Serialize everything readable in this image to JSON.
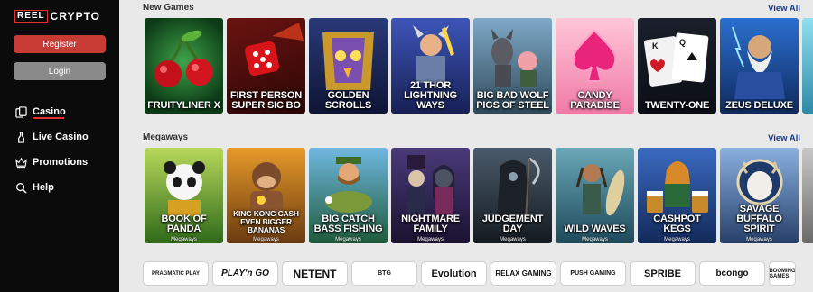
{
  "brand": {
    "reel": "REEL",
    "crypto": "CRYPTO"
  },
  "auth": {
    "register": "Register",
    "login": "Login"
  },
  "nav": [
    {
      "label": "Casino",
      "icon": "cards-icon"
    },
    {
      "label": "Live Casino",
      "icon": "bottle-icon"
    },
    {
      "label": "Promotions",
      "icon": "crown-icon"
    },
    {
      "label": "Help",
      "icon": "search-icon"
    }
  ],
  "sections": [
    {
      "title": "New Games",
      "view_all": "View All",
      "games": [
        {
          "title": "FRUITYLINER X",
          "sub": ""
        },
        {
          "title": "FIRST PERSON SUPER SIC BO",
          "sub": ""
        },
        {
          "title": "GOLDEN SCROLLS",
          "sub": ""
        },
        {
          "title": "21 THOR LIGHTNING WAYS",
          "sub": ""
        },
        {
          "title": "BIG BAD WOLF PIGS OF STEEL",
          "sub": ""
        },
        {
          "title": "CANDY PARADISE",
          "sub": ""
        },
        {
          "title": "TWENTY-ONE",
          "sub": ""
        },
        {
          "title": "ZEUS DELUXE",
          "sub": ""
        }
      ]
    },
    {
      "title": "Megaways",
      "view_all": "View All",
      "games": [
        {
          "title": "BOOK OF PANDA",
          "sub": "Megaways"
        },
        {
          "title": "KING KONG CASH EVEN BIGGER BANANAS",
          "sub": "Megaways"
        },
        {
          "title": "BIG CATCH BASS FISHING",
          "sub": "Megaways"
        },
        {
          "title": "NIGHTMARE FAMILY",
          "sub": "Megaways"
        },
        {
          "title": "JUDGEMENT DAY",
          "sub": "Megaways"
        },
        {
          "title": "WILD WAVES",
          "sub": "Megaways"
        },
        {
          "title": "CASHPOT KEGS",
          "sub": "Megaways"
        },
        {
          "title": "SAVAGE BUFFALO SPIRIT",
          "sub": "Megaways"
        }
      ]
    }
  ],
  "providers": [
    "PRAGMATIC PLAY",
    "PLAY'n GO",
    "NETENT",
    "BTG",
    "Evolution",
    "RELAX GAMING",
    "PUSH GAMING",
    "SPRIBE",
    "bcongo",
    "BOOMING GAMES"
  ],
  "colors": {
    "accent": "#c83a34",
    "link": "#1b3c84",
    "sidebar": "#0b0b0b"
  }
}
